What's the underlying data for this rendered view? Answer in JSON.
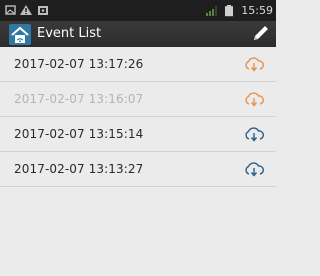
{
  "status_bar": {
    "time": "15:59"
  },
  "header": {
    "title": "Event List",
    "app_icon": "home-wifi-icon",
    "edit_icon": "pencil-icon"
  },
  "events": [
    {
      "timestamp": "2017-02-07 13:17:26",
      "icon": "cloud-download-icon",
      "icon_color": "#e8914a",
      "dimmed": false
    },
    {
      "timestamp": "2017-02-07 13:16:07",
      "icon": "cloud-download-icon",
      "icon_color": "#e8914a",
      "dimmed": true
    },
    {
      "timestamp": "2017-02-07 13:15:14",
      "icon": "cloud-download-icon",
      "icon_color": "#2a5d8c",
      "dimmed": false
    },
    {
      "timestamp": "2017-02-07 13:13:27",
      "icon": "cloud-download-icon",
      "icon_color": "#2a5d8c",
      "dimmed": false
    }
  ],
  "colors": {
    "status_bar_bg": "#1e1e1e",
    "action_bar_bg": "#333333",
    "list_bg": "#ebebeb",
    "accent_orange": "#e8914a",
    "accent_blue": "#2a5d8c"
  }
}
